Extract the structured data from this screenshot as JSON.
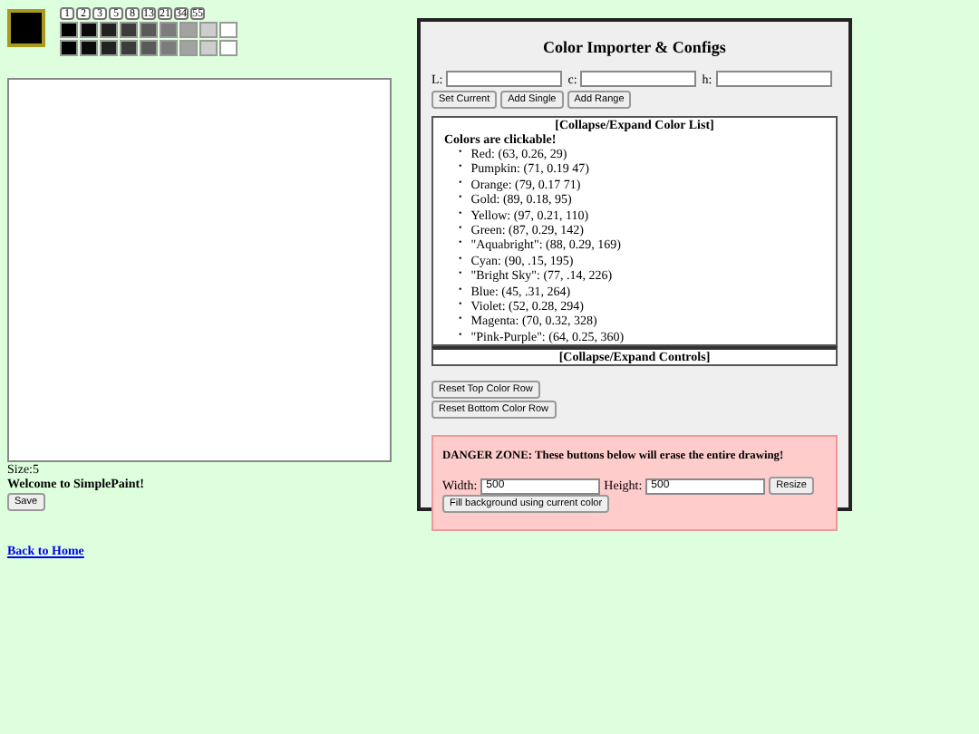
{
  "current_color": {
    "color": "#000000"
  },
  "sizes": [
    "1",
    "2",
    "3",
    "5",
    "8",
    "13",
    "21",
    "34",
    "55"
  ],
  "palette_top": [
    {
      "color": "#000000"
    },
    {
      "color": "#0a0a0a"
    },
    {
      "color": "#222222"
    },
    {
      "color": "#3c3c3c"
    },
    {
      "color": "#5a5a5a"
    },
    {
      "color": "#7c7c7c"
    },
    {
      "color": "#a2a2a2"
    },
    {
      "color": "#cdcdcd"
    },
    {
      "color": "#ffffff"
    }
  ],
  "palette_bottom": [
    {
      "color": "#000000"
    },
    {
      "color": "#0a0a0a"
    },
    {
      "color": "#222222"
    },
    {
      "color": "#3c3c3c"
    },
    {
      "color": "#5a5a5a"
    },
    {
      "color": "#7c7c7c"
    },
    {
      "color": "#a2a2a2"
    },
    {
      "color": "#cdcdcd"
    },
    {
      "color": "#ffffff"
    }
  ],
  "size_label": "Size:5",
  "welcome": "Welcome to SimplePaint!",
  "save_button": "Save",
  "back_link": "Back to Home",
  "panel": {
    "title": "Color Importer & Configs",
    "fields": [
      {
        "label": "L:"
      },
      {
        "label": "c:"
      },
      {
        "label": "h:"
      }
    ],
    "buttons": [
      "Set Current",
      "Add Single",
      "Add Range"
    ],
    "list_toggle": "[Collapse/Expand Color List]",
    "list_heading": "Colors are clickable!",
    "bullet": "•",
    "colors": [
      "Red: (63, 0.26, 29)",
      "Pumpkin: (71, 0.19 47)",
      "Orange: (79, 0.17 71)",
      "Gold: (89, 0.18, 95)",
      "Yellow: (97, 0.21, 110)",
      "Green: (87, 0.29, 142)",
      "\"Aquabright\": (88, 0.29, 169)",
      "Cyan: (90, .15, 195)",
      "\"Bright Sky\": (77, .14, 226)",
      "Blue: (45, .31, 264)",
      "Violet: (52, 0.28, 294)",
      "Magenta: (70, 0.32, 328)",
      "\"Pink-Purple\": (64, 0.25, 360)"
    ],
    "controls_toggle": "[Collapse/Expand Controls]",
    "reset_buttons": [
      "Reset Top Color Row",
      "Reset Bottom Color Row"
    ],
    "danger": {
      "warning": "DANGER ZONE: These buttons below will erase the entire drawing!",
      "width_label": "Width:",
      "width_value": "500",
      "height_label": "Height:",
      "height_value": "500",
      "resize_button": "Resize",
      "fill_button": "Fill background using current color"
    }
  }
}
